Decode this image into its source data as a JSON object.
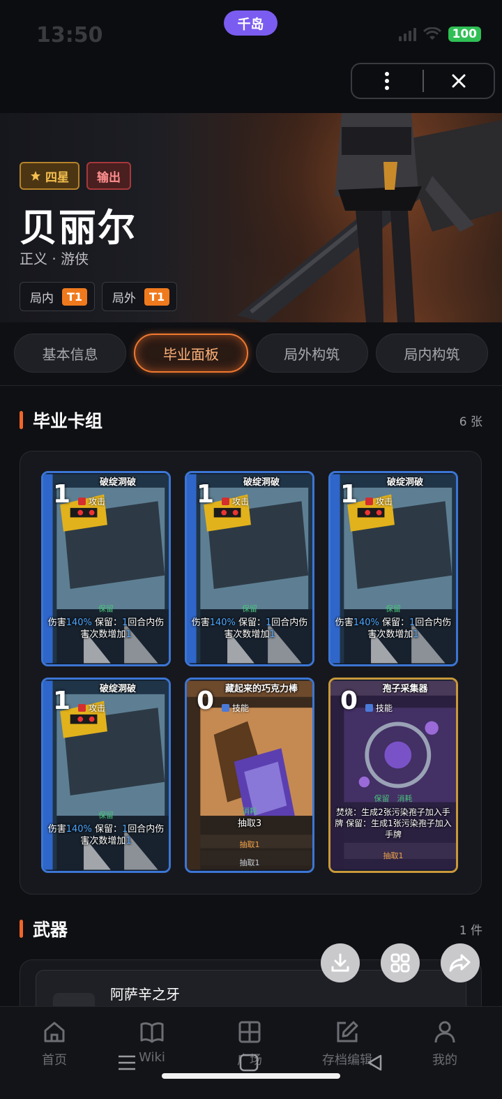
{
  "status": {
    "time": "13:50",
    "island": "千岛",
    "battery": "100"
  },
  "header": {
    "more_icon": "more-vertical-icon",
    "close_icon": "close-icon"
  },
  "character": {
    "rarity": "四星",
    "role": "输出",
    "name": "贝丽尔",
    "subtitle": "正义 · 游侠",
    "tiers": [
      {
        "label": "局内",
        "value": "T1"
      },
      {
        "label": "局外",
        "value": "T1"
      }
    ]
  },
  "tabs": [
    {
      "label": "基本信息",
      "active": false
    },
    {
      "label": "毕业面板",
      "active": true
    },
    {
      "label": "局外构筑",
      "active": false
    },
    {
      "label": "局内构筑",
      "active": false
    }
  ],
  "deck": {
    "title": "毕业卡组",
    "count": "6 张",
    "cards": [
      {
        "cost": "1",
        "name": "破绽洞破",
        "type": "攻击",
        "tag": "保留",
        "desc": [
          "伤害",
          "140%",
          " 保留：",
          "1",
          "回合内伤害次数增加",
          "1"
        ]
      },
      {
        "cost": "1",
        "name": "破绽洞破",
        "type": "攻击",
        "tag": "保留",
        "desc": [
          "伤害",
          "140%",
          " 保留：",
          "1",
          "回合内伤害次数增加",
          "1"
        ]
      },
      {
        "cost": "1",
        "name": "破绽洞破",
        "type": "攻击",
        "tag": "保留",
        "desc": [
          "伤害",
          "140%",
          " 保留：",
          "1",
          "回合内伤害次数增加",
          "1"
        ]
      },
      {
        "cost": "1",
        "name": "破绽洞破",
        "type": "攻击",
        "tag": "保留",
        "desc": [
          "伤害",
          "140%",
          " 保留：",
          "1",
          "回合内伤害次数增加",
          "1"
        ]
      },
      {
        "cost": "0",
        "name": "藏起来的巧克力棒",
        "type": "技能",
        "tag": "消耗",
        "desc_text": "抽取3",
        "foot1": "抽取1",
        "foot2": "抽取1"
      },
      {
        "cost": "0",
        "name": "孢子采集器",
        "type": "技能",
        "tag": "保留　消耗",
        "desc_text": "焚烧：生成2张污染孢子加入手牌 保留：生成1张污染孢子加入手牌",
        "foot1": "抽取1"
      }
    ]
  },
  "weapon": {
    "title": "武器",
    "count": "1 件",
    "name": "阿萨辛之牙"
  },
  "fabs": [
    "download-icon",
    "grid-icon",
    "share-icon"
  ],
  "nav": [
    {
      "label": "首页",
      "icon": "home-icon"
    },
    {
      "label": "Wiki",
      "icon": "book-icon"
    },
    {
      "label": "广场",
      "icon": "square-grid-icon"
    },
    {
      "label": "存档编辑",
      "icon": "edit-icon"
    },
    {
      "label": "我的",
      "icon": "user-icon"
    }
  ]
}
